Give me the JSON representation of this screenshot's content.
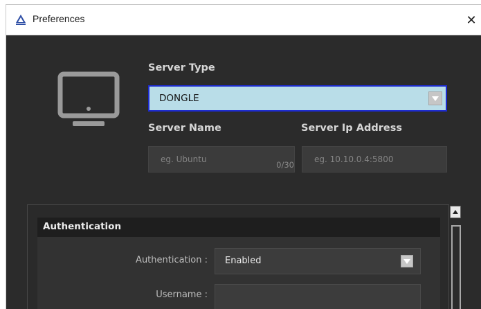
{
  "window": {
    "title": "Preferences",
    "close_symbol": "✕",
    "icons": {
      "app": "app-logo-icon",
      "close": "close-icon",
      "device": "monitor-icon"
    }
  },
  "server": {
    "type_label": "Server Type",
    "type_value": "DONGLE",
    "name_label": "Server Name",
    "name_placeholder": "eg. Ubuntu",
    "name_counter": "0/30",
    "ip_label": "Server Ip Address",
    "ip_placeholder": "eg. 10.10.0.4:5800"
  },
  "authentication": {
    "section_title": "Authentication",
    "auth_label": "Authentication :",
    "auth_value": "Enabled",
    "username_label": "Username :"
  },
  "colors": {
    "selected_dropdown": "#b9dde8",
    "focus_border": "#1d2bd0",
    "background": "#2b2b2b"
  }
}
